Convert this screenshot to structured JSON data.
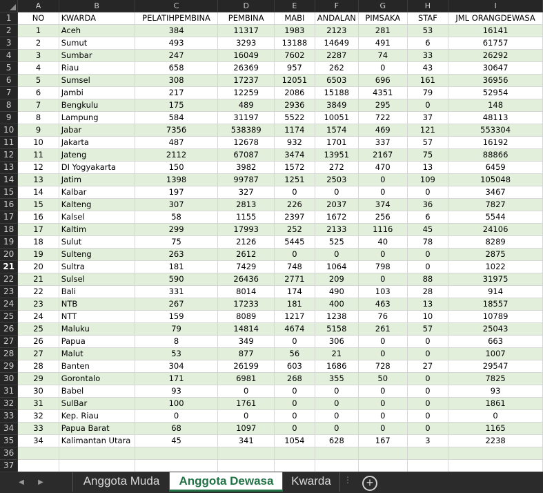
{
  "columns": [
    "A",
    "B",
    "C",
    "D",
    "E",
    "F",
    "G",
    "H",
    "I"
  ],
  "headers": [
    "NO",
    "KWARDA",
    "PELATIHPEMBINA",
    "PEMBINA",
    "MABI",
    "ANDALAN",
    "PIMSAKA",
    "STAF",
    "JML ORANGDEWASA"
  ],
  "rows": [
    [
      "1",
      "Aceh",
      "384",
      "11317",
      "1983",
      "2123",
      "281",
      "53",
      "16141"
    ],
    [
      "2",
      "Sumut",
      "493",
      "3293",
      "13188",
      "14649",
      "491",
      "6",
      "61757"
    ],
    [
      "3",
      "Sumbar",
      "247",
      "16049",
      "7602",
      "2287",
      "74",
      "33",
      "26292"
    ],
    [
      "4",
      "Riau",
      "658",
      "26369",
      "957",
      "262",
      "0",
      "43",
      "30647"
    ],
    [
      "5",
      "Sumsel",
      "308",
      "17237",
      "12051",
      "6503",
      "696",
      "161",
      "36956"
    ],
    [
      "6",
      "Jambi",
      "217",
      "12259",
      "2086",
      "15188",
      "4351",
      "79",
      "52954"
    ],
    [
      "7",
      "Bengkulu",
      "175",
      "489",
      "2936",
      "3849",
      "295",
      "0",
      "148"
    ],
    [
      "8",
      "Lampung",
      "584",
      "31197",
      "5522",
      "10051",
      "722",
      "37",
      "48113"
    ],
    [
      "9",
      "Jabar",
      "7356",
      "538389",
      "1174",
      "1574",
      "469",
      "121",
      "553304"
    ],
    [
      "10",
      "Jakarta",
      "487",
      "12678",
      "932",
      "1701",
      "337",
      "57",
      "16192"
    ],
    [
      "11",
      "Jateng",
      "2112",
      "67087",
      "3474",
      "13951",
      "2167",
      "75",
      "88866"
    ],
    [
      "12",
      "DI Yogyakarta",
      "150",
      "3982",
      "1572",
      "272",
      "470",
      "13",
      "6459"
    ],
    [
      "13",
      "Jatim",
      "1398",
      "99787",
      "1251",
      "2503",
      "0",
      "109",
      "105048"
    ],
    [
      "14",
      "Kalbar",
      "197",
      "327",
      "0",
      "0",
      "0",
      "0",
      "3467"
    ],
    [
      "15",
      "Kalteng",
      "307",
      "2813",
      "226",
      "2037",
      "374",
      "36",
      "7827"
    ],
    [
      "16",
      "Kalsel",
      "58",
      "1155",
      "2397",
      "1672",
      "256",
      "6",
      "5544"
    ],
    [
      "17",
      "Kaltim",
      "299",
      "17993",
      "252",
      "2133",
      "1116",
      "45",
      "24106"
    ],
    [
      "18",
      "Sulut",
      "75",
      "2126",
      "5445",
      "525",
      "40",
      "78",
      "8289"
    ],
    [
      "19",
      "Sulteng",
      "263",
      "2612",
      "0",
      "0",
      "0",
      "0",
      "2875"
    ],
    [
      "20",
      "Sultra",
      "181",
      "7429",
      "748",
      "1064",
      "798",
      "0",
      "1022"
    ],
    [
      "21",
      "Sulsel",
      "590",
      "26436",
      "2771",
      "209",
      "0",
      "88",
      "31975"
    ],
    [
      "22",
      "Bali",
      "331",
      "8014",
      "174",
      "490",
      "103",
      "28",
      "914"
    ],
    [
      "23",
      "NTB",
      "267",
      "17233",
      "181",
      "400",
      "463",
      "13",
      "18557"
    ],
    [
      "24",
      "NTT",
      "159",
      "8089",
      "1217",
      "1238",
      "76",
      "10",
      "10789"
    ],
    [
      "25",
      "Maluku",
      "79",
      "14814",
      "4674",
      "5158",
      "261",
      "57",
      "25043"
    ],
    [
      "26",
      "Papua",
      "8",
      "349",
      "0",
      "306",
      "0",
      "0",
      "663"
    ],
    [
      "27",
      "Malut",
      "53",
      "877",
      "56",
      "21",
      "0",
      "0",
      "1007"
    ],
    [
      "28",
      "Banten",
      "304",
      "26199",
      "603",
      "1686",
      "728",
      "27",
      "29547"
    ],
    [
      "29",
      "Gorontalo",
      "171",
      "6981",
      "268",
      "355",
      "50",
      "0",
      "7825"
    ],
    [
      "30",
      "Babel",
      "93",
      "0",
      "0",
      "0",
      "0",
      "0",
      "93"
    ],
    [
      "31",
      "SulBar",
      "100",
      "1761",
      "0",
      "0",
      "0",
      "0",
      "1861"
    ],
    [
      "32",
      "Kep. Riau",
      "0",
      "0",
      "0",
      "0",
      "0",
      "0",
      "0"
    ],
    [
      "33",
      "Papua Barat",
      "68",
      "1097",
      "0",
      "0",
      "0",
      "0",
      "1165"
    ],
    [
      "34",
      "Kalimantan Utara",
      "45",
      "341",
      "1054",
      "628",
      "167",
      "3",
      "2238"
    ]
  ],
  "row_numbers": [
    "1",
    "2",
    "3",
    "4",
    "5",
    "6",
    "7",
    "8",
    "9",
    "10",
    "11",
    "12",
    "13",
    "14",
    "15",
    "16",
    "17",
    "18",
    "19",
    "20",
    "21",
    "22",
    "23",
    "24",
    "25",
    "26",
    "27",
    "28",
    "29",
    "30",
    "31",
    "32",
    "33",
    "34",
    "35",
    "36",
    "37"
  ],
  "selected_row": "21",
  "sheet_tabs": [
    {
      "label": "Anggota Muda",
      "active": false
    },
    {
      "label": "Anggota Dewasa",
      "active": true
    },
    {
      "label": "Kwarda",
      "active": false
    }
  ],
  "icons": {
    "nav_left": "triangle-left-icon",
    "nav_right": "triangle-right-icon",
    "add_sheet": "plus-circle-icon"
  },
  "colors": {
    "band": "#e2efda",
    "active_tab_text": "#217346",
    "header_bg": "#262626"
  }
}
